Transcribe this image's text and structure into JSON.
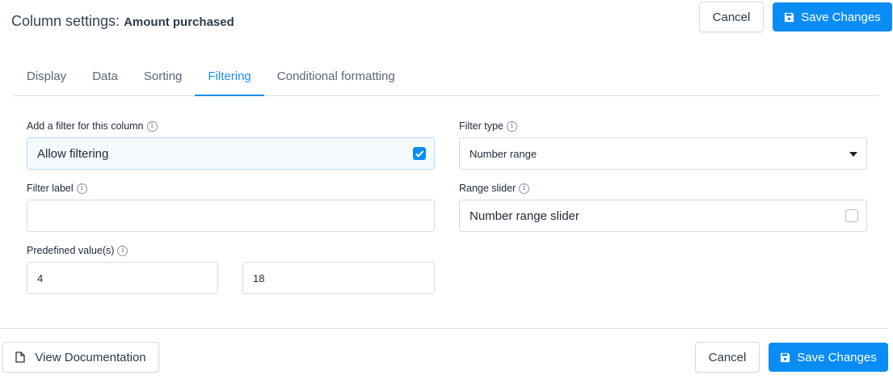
{
  "header": {
    "title_prefix": "Column settings:",
    "column_name": "Amount purchased",
    "cancel": "Cancel",
    "save": "Save Changes"
  },
  "tabs": [
    {
      "label": "Display"
    },
    {
      "label": "Data"
    },
    {
      "label": "Sorting"
    },
    {
      "label": "Filtering",
      "active": true
    },
    {
      "label": "Conditional formatting"
    }
  ],
  "form": {
    "add_filter": {
      "label": "Add a filter for this column",
      "option": "Allow filtering",
      "checked": true
    },
    "filter_type": {
      "label": "Filter type",
      "value": "Number range"
    },
    "filter_label": {
      "label": "Filter label",
      "value": ""
    },
    "range_slider": {
      "label": "Range slider",
      "option": "Number range slider",
      "checked": false
    },
    "predefined": {
      "label": "Predefined value(s)",
      "min": "4",
      "max": "18"
    }
  },
  "footer": {
    "docs": "View Documentation",
    "cancel": "Cancel",
    "save": "Save Changes"
  },
  "colors": {
    "accent": "#0a8cf5"
  }
}
